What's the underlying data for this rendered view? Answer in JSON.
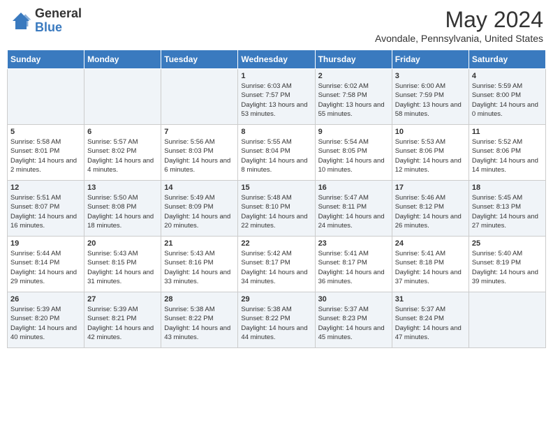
{
  "header": {
    "logo_general": "General",
    "logo_blue": "Blue",
    "month_title": "May 2024",
    "location": "Avondale, Pennsylvania, United States"
  },
  "days_of_week": [
    "Sunday",
    "Monday",
    "Tuesday",
    "Wednesday",
    "Thursday",
    "Friday",
    "Saturday"
  ],
  "weeks": [
    [
      {
        "day": "",
        "info": ""
      },
      {
        "day": "",
        "info": ""
      },
      {
        "day": "",
        "info": ""
      },
      {
        "day": "1",
        "info": "Sunrise: 6:03 AM\nSunset: 7:57 PM\nDaylight: 13 hours and 53 minutes."
      },
      {
        "day": "2",
        "info": "Sunrise: 6:02 AM\nSunset: 7:58 PM\nDaylight: 13 hours and 55 minutes."
      },
      {
        "day": "3",
        "info": "Sunrise: 6:00 AM\nSunset: 7:59 PM\nDaylight: 13 hours and 58 minutes."
      },
      {
        "day": "4",
        "info": "Sunrise: 5:59 AM\nSunset: 8:00 PM\nDaylight: 14 hours and 0 minutes."
      }
    ],
    [
      {
        "day": "5",
        "info": "Sunrise: 5:58 AM\nSunset: 8:01 PM\nDaylight: 14 hours and 2 minutes."
      },
      {
        "day": "6",
        "info": "Sunrise: 5:57 AM\nSunset: 8:02 PM\nDaylight: 14 hours and 4 minutes."
      },
      {
        "day": "7",
        "info": "Sunrise: 5:56 AM\nSunset: 8:03 PM\nDaylight: 14 hours and 6 minutes."
      },
      {
        "day": "8",
        "info": "Sunrise: 5:55 AM\nSunset: 8:04 PM\nDaylight: 14 hours and 8 minutes."
      },
      {
        "day": "9",
        "info": "Sunrise: 5:54 AM\nSunset: 8:05 PM\nDaylight: 14 hours and 10 minutes."
      },
      {
        "day": "10",
        "info": "Sunrise: 5:53 AM\nSunset: 8:06 PM\nDaylight: 14 hours and 12 minutes."
      },
      {
        "day": "11",
        "info": "Sunrise: 5:52 AM\nSunset: 8:06 PM\nDaylight: 14 hours and 14 minutes."
      }
    ],
    [
      {
        "day": "12",
        "info": "Sunrise: 5:51 AM\nSunset: 8:07 PM\nDaylight: 14 hours and 16 minutes."
      },
      {
        "day": "13",
        "info": "Sunrise: 5:50 AM\nSunset: 8:08 PM\nDaylight: 14 hours and 18 minutes."
      },
      {
        "day": "14",
        "info": "Sunrise: 5:49 AM\nSunset: 8:09 PM\nDaylight: 14 hours and 20 minutes."
      },
      {
        "day": "15",
        "info": "Sunrise: 5:48 AM\nSunset: 8:10 PM\nDaylight: 14 hours and 22 minutes."
      },
      {
        "day": "16",
        "info": "Sunrise: 5:47 AM\nSunset: 8:11 PM\nDaylight: 14 hours and 24 minutes."
      },
      {
        "day": "17",
        "info": "Sunrise: 5:46 AM\nSunset: 8:12 PM\nDaylight: 14 hours and 26 minutes."
      },
      {
        "day": "18",
        "info": "Sunrise: 5:45 AM\nSunset: 8:13 PM\nDaylight: 14 hours and 27 minutes."
      }
    ],
    [
      {
        "day": "19",
        "info": "Sunrise: 5:44 AM\nSunset: 8:14 PM\nDaylight: 14 hours and 29 minutes."
      },
      {
        "day": "20",
        "info": "Sunrise: 5:43 AM\nSunset: 8:15 PM\nDaylight: 14 hours and 31 minutes."
      },
      {
        "day": "21",
        "info": "Sunrise: 5:43 AM\nSunset: 8:16 PM\nDaylight: 14 hours and 33 minutes."
      },
      {
        "day": "22",
        "info": "Sunrise: 5:42 AM\nSunset: 8:17 PM\nDaylight: 14 hours and 34 minutes."
      },
      {
        "day": "23",
        "info": "Sunrise: 5:41 AM\nSunset: 8:17 PM\nDaylight: 14 hours and 36 minutes."
      },
      {
        "day": "24",
        "info": "Sunrise: 5:41 AM\nSunset: 8:18 PM\nDaylight: 14 hours and 37 minutes."
      },
      {
        "day": "25",
        "info": "Sunrise: 5:40 AM\nSunset: 8:19 PM\nDaylight: 14 hours and 39 minutes."
      }
    ],
    [
      {
        "day": "26",
        "info": "Sunrise: 5:39 AM\nSunset: 8:20 PM\nDaylight: 14 hours and 40 minutes."
      },
      {
        "day": "27",
        "info": "Sunrise: 5:39 AM\nSunset: 8:21 PM\nDaylight: 14 hours and 42 minutes."
      },
      {
        "day": "28",
        "info": "Sunrise: 5:38 AM\nSunset: 8:22 PM\nDaylight: 14 hours and 43 minutes."
      },
      {
        "day": "29",
        "info": "Sunrise: 5:38 AM\nSunset: 8:22 PM\nDaylight: 14 hours and 44 minutes."
      },
      {
        "day": "30",
        "info": "Sunrise: 5:37 AM\nSunset: 8:23 PM\nDaylight: 14 hours and 45 minutes."
      },
      {
        "day": "31",
        "info": "Sunrise: 5:37 AM\nSunset: 8:24 PM\nDaylight: 14 hours and 47 minutes."
      },
      {
        "day": "",
        "info": ""
      }
    ]
  ]
}
